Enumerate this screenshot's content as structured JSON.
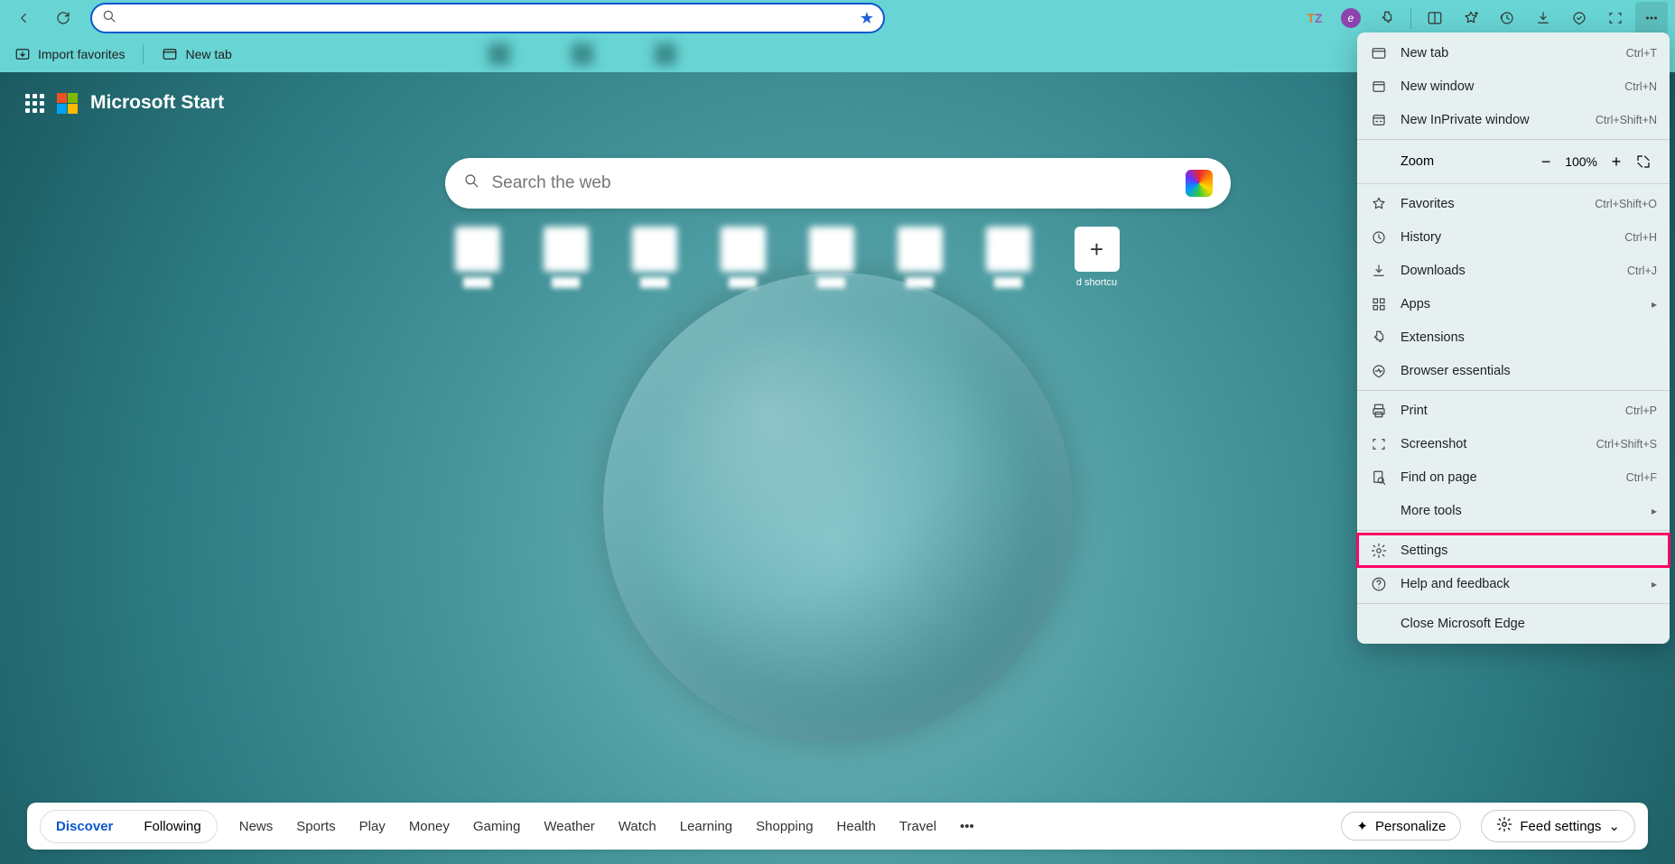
{
  "toolbar": {
    "address_value": "",
    "address_placeholder": ""
  },
  "fav_bar": {
    "import": "Import favorites",
    "new_tab": "New tab"
  },
  "start": {
    "brand": "Microsoft Start",
    "search_placeholder": "Search the web",
    "add_shortcut": "d shortcu"
  },
  "feed": {
    "tabs": [
      "Discover",
      "Following"
    ],
    "links": [
      "News",
      "Sports",
      "Play",
      "Money",
      "Gaming",
      "Weather",
      "Watch",
      "Learning",
      "Shopping",
      "Health",
      "Travel"
    ],
    "personalize": "Personalize",
    "feed_settings": "Feed settings"
  },
  "menu": {
    "new_tab": {
      "label": "New tab",
      "shortcut": "Ctrl+T"
    },
    "new_window": {
      "label": "New window",
      "shortcut": "Ctrl+N"
    },
    "inprivate": {
      "label": "New InPrivate window",
      "shortcut": "Ctrl+Shift+N"
    },
    "zoom_label": "Zoom",
    "zoom_value": "100%",
    "favorites": {
      "label": "Favorites",
      "shortcut": "Ctrl+Shift+O"
    },
    "history": {
      "label": "History",
      "shortcut": "Ctrl+H"
    },
    "downloads": {
      "label": "Downloads",
      "shortcut": "Ctrl+J"
    },
    "apps": {
      "label": "Apps"
    },
    "extensions": {
      "label": "Extensions"
    },
    "essentials": {
      "label": "Browser essentials"
    },
    "print": {
      "label": "Print",
      "shortcut": "Ctrl+P"
    },
    "screenshot": {
      "label": "Screenshot",
      "shortcut": "Ctrl+Shift+S"
    },
    "find": {
      "label": "Find on page",
      "shortcut": "Ctrl+F"
    },
    "more_tools": {
      "label": "More tools"
    },
    "settings": {
      "label": "Settings"
    },
    "help": {
      "label": "Help and feedback"
    },
    "close": {
      "label": "Close Microsoft Edge"
    }
  }
}
